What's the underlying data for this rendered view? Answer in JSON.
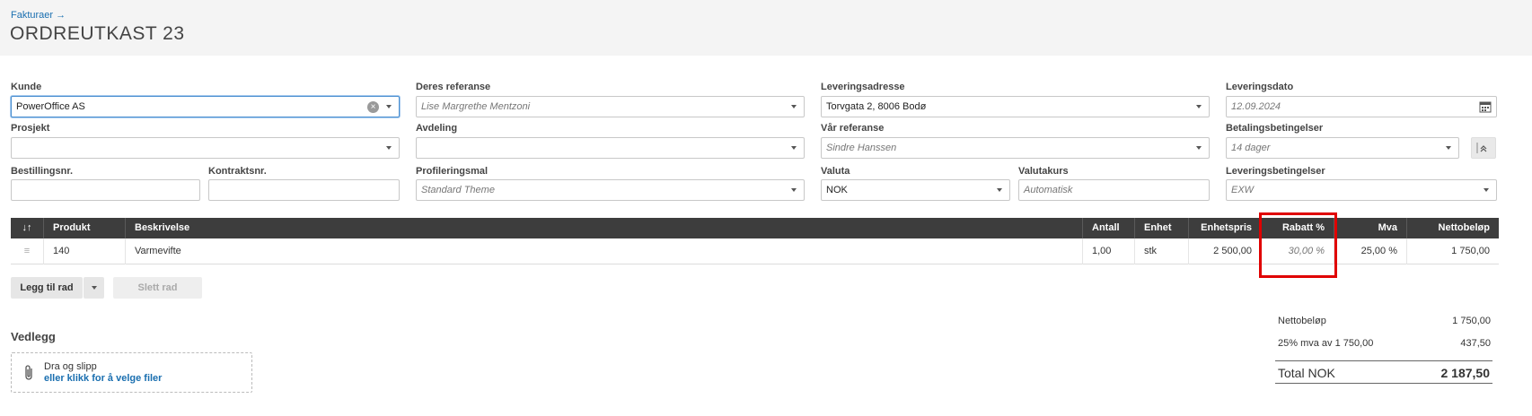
{
  "header": {
    "breadcrumb": "Fakturaer →",
    "title": "ORDREUTKAST 23"
  },
  "form": {
    "kunde": {
      "label": "Kunde",
      "value": "PowerOffice AS"
    },
    "deres_referanse": {
      "label": "Deres referanse",
      "placeholder": "Lise Margrethe Mentzoni"
    },
    "leveringsadresse": {
      "label": "Leveringsadresse",
      "value": "Torvgata 2, 8006 Bodø"
    },
    "leveringsdato": {
      "label": "Leveringsdato",
      "placeholder": "12.09.2024"
    },
    "prosjekt": {
      "label": "Prosjekt",
      "value": ""
    },
    "avdeling": {
      "label": "Avdeling",
      "value": ""
    },
    "var_referanse": {
      "label": "Vår referanse",
      "placeholder": "Sindre Hanssen"
    },
    "betalingsbetingelser": {
      "label": "Betalingsbetingelser",
      "placeholder": "14 dager"
    },
    "bestillingsnr": {
      "label": "Bestillingsnr.",
      "value": ""
    },
    "kontraktsnr": {
      "label": "Kontraktsnr.",
      "value": ""
    },
    "profileringsmal": {
      "label": "Profileringsmal",
      "placeholder": "Standard Theme"
    },
    "valuta": {
      "label": "Valuta",
      "value": "NOK"
    },
    "valutakurs": {
      "label": "Valutakurs",
      "placeholder": "Automatisk"
    },
    "leveringsbetingelser": {
      "label": "Leveringsbetingelser",
      "placeholder": "EXW"
    }
  },
  "table": {
    "sort_icon": "↓↑",
    "columns": [
      "Produkt",
      "Beskrivelse",
      "Antall",
      "Enhet",
      "Enhetspris",
      "Rabatt %",
      "Mva",
      "Nettobeløp"
    ],
    "rows": [
      {
        "produkt": "140",
        "beskrivelse": "Varmevifte",
        "antall": "1,00",
        "enhet": "stk",
        "enhetspris": "2 500,00",
        "rabatt": "30,00 %",
        "mva": "25,00 %",
        "netto": "1 750,00"
      }
    ]
  },
  "actions": {
    "add_row": "Legg til rad",
    "delete_row": "Slett rad"
  },
  "attachments": {
    "title": "Vedlegg",
    "drop_text": "Dra og slipp",
    "click_text": "eller klikk for å velge filer"
  },
  "summary": {
    "netto_label": "Nettobeløp",
    "netto_value": "1 750,00",
    "mva_label": "25% mva av 1 750,00",
    "mva_value": "437,50",
    "total_label": "Total NOK",
    "total_value": "2 187,50"
  },
  "colors": {
    "accent": "#1a6fb0",
    "header_bg": "#3d3d3d",
    "highlight": "#e00000"
  }
}
